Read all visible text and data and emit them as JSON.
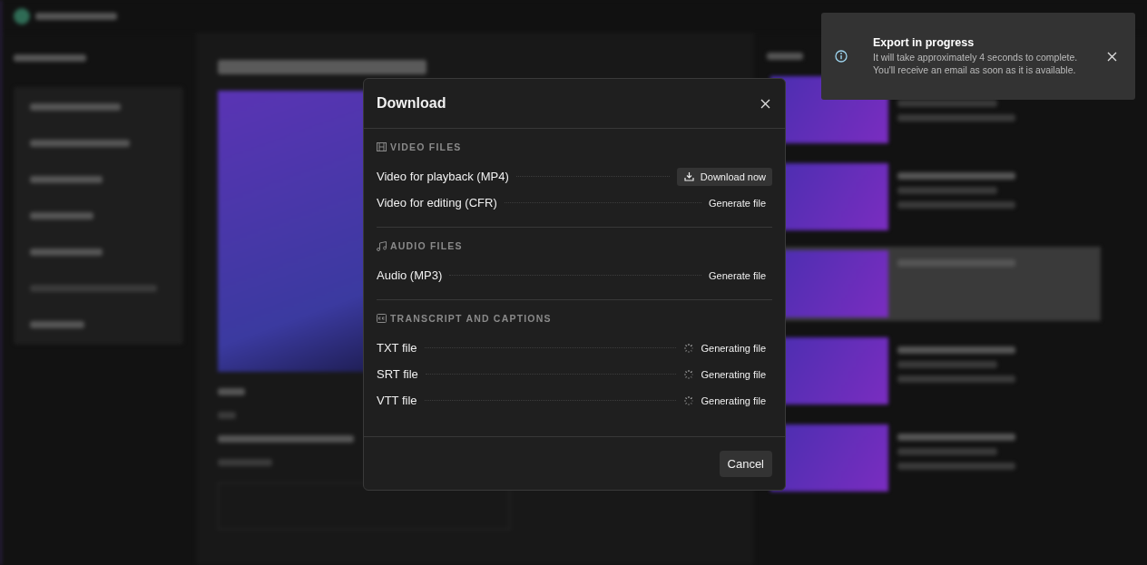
{
  "dialog": {
    "title": "Download",
    "sections": [
      {
        "kind": "video",
        "heading": "VIDEO FILES",
        "files": [
          {
            "name": "Video for playback (MP4)",
            "kind": "ready",
            "action": "Download now"
          },
          {
            "name": "Video for editing (CFR)",
            "kind": "generate",
            "action": "Generate file"
          }
        ]
      },
      {
        "kind": "audio",
        "heading": "AUDIO FILES",
        "files": [
          {
            "name": "Audio (MP3)",
            "kind": "generate",
            "action": "Generate file"
          }
        ]
      },
      {
        "kind": "captions",
        "heading": "TRANSCRIPT AND CAPTIONS",
        "files": [
          {
            "name": "TXT file",
            "kind": "generating",
            "action": "Generating file"
          },
          {
            "name": "SRT file",
            "kind": "generating",
            "action": "Generating file"
          },
          {
            "name": "VTT file",
            "kind": "generating",
            "action": "Generating file"
          }
        ]
      }
    ],
    "cancel": "Cancel"
  },
  "toast": {
    "title": "Export in progress",
    "message": "It will take approximately 4 seconds to complete. You'll receive an email as soon as it is available."
  }
}
